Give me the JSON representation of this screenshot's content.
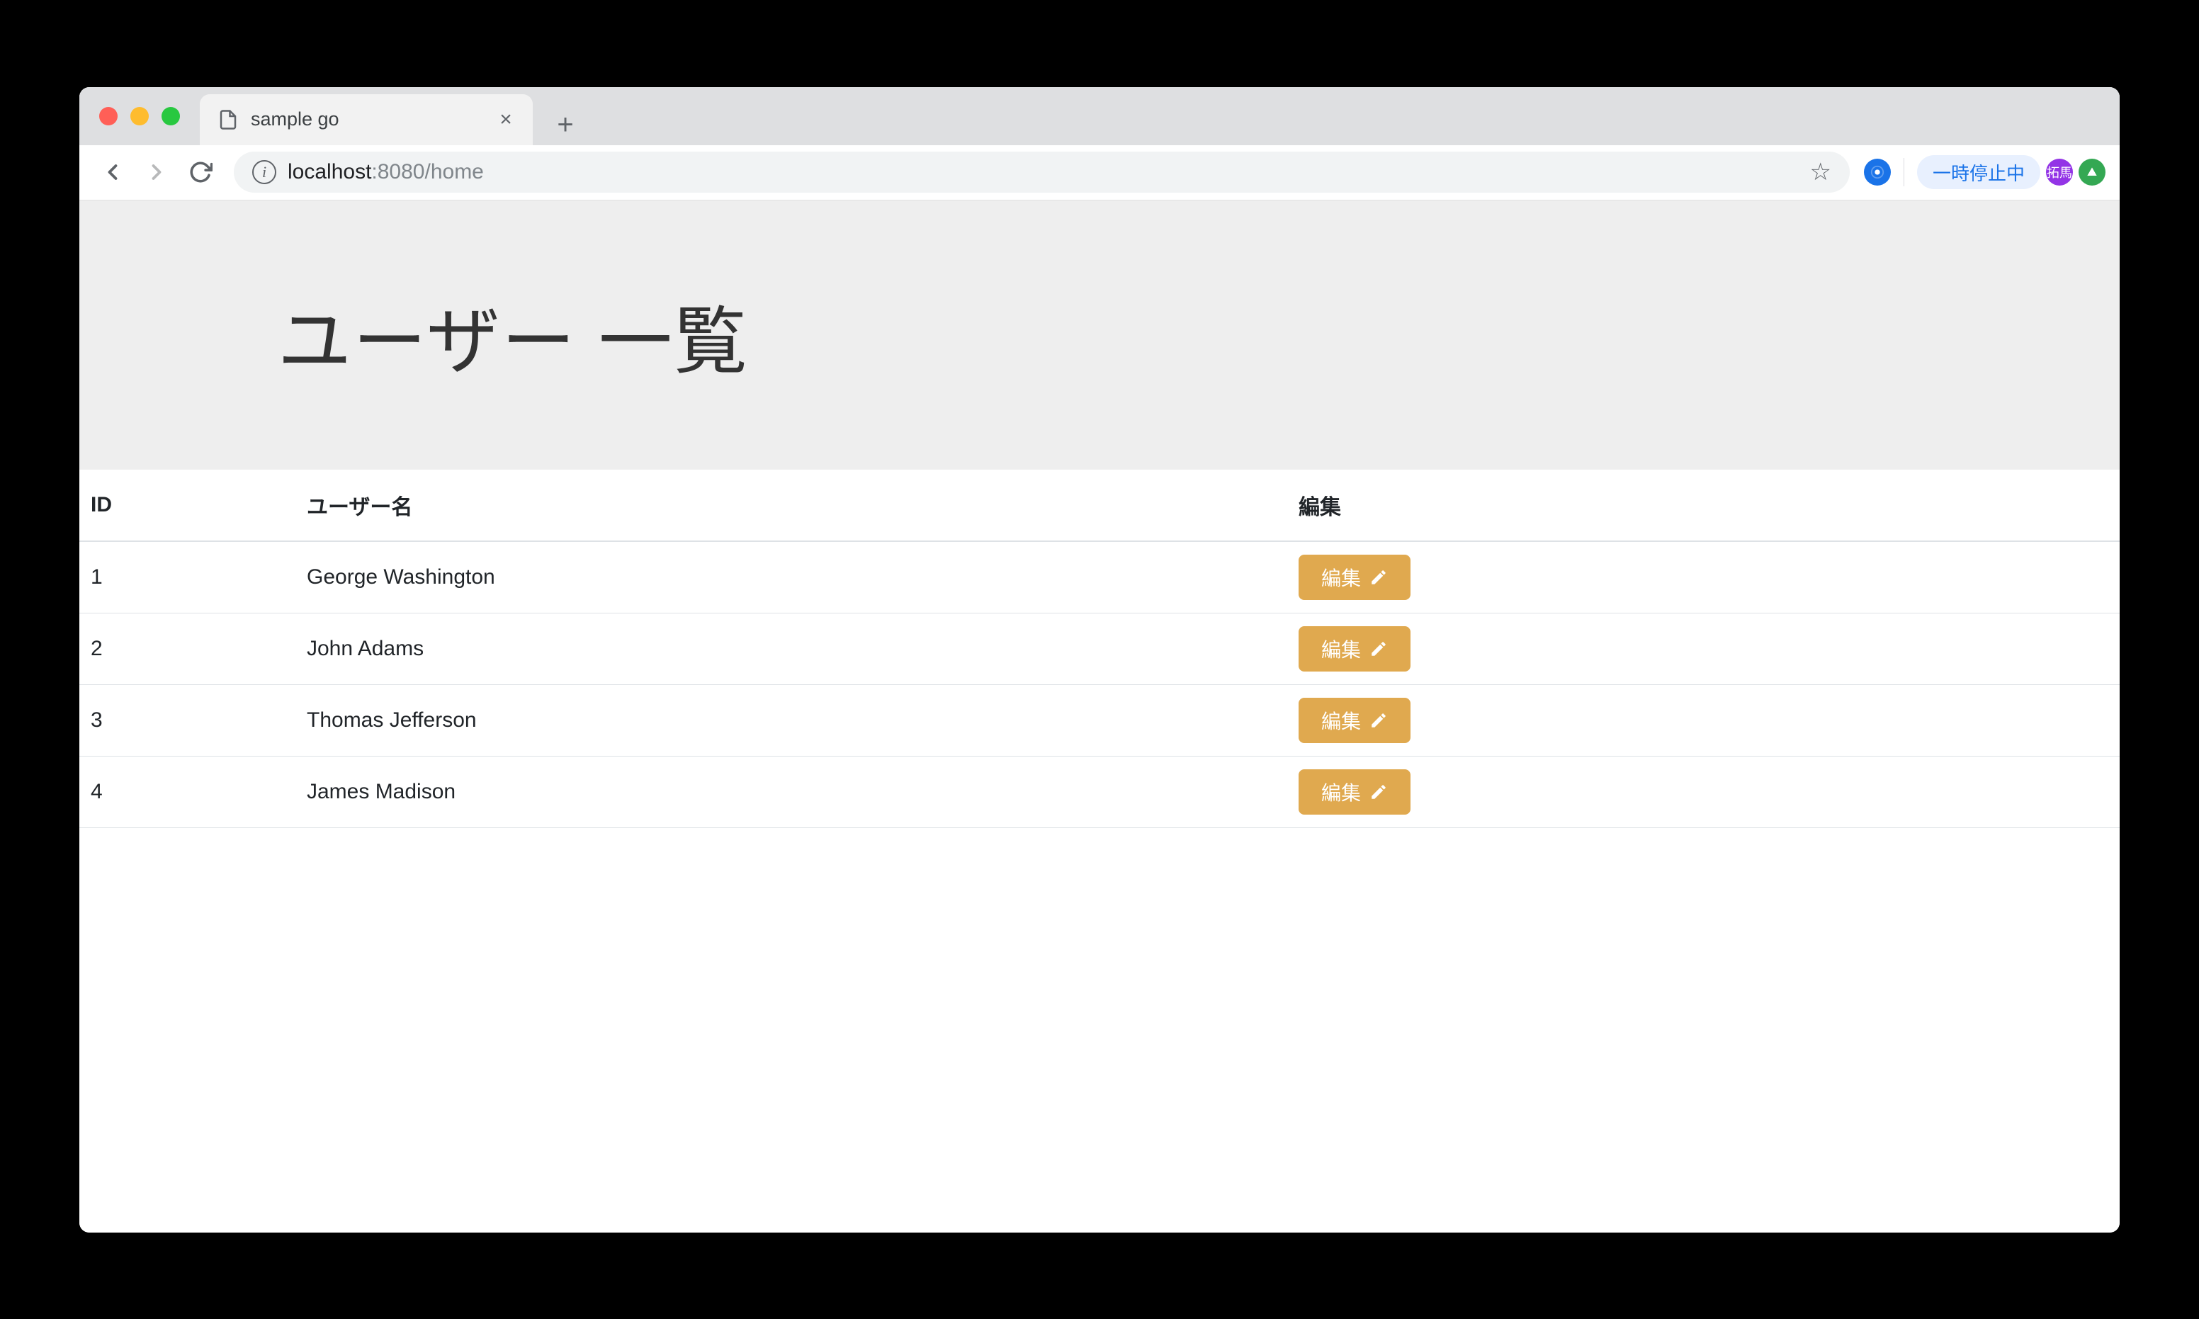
{
  "browser": {
    "tab_title": "sample go",
    "url_host": "localhost",
    "url_port": ":8080",
    "url_path": "/home",
    "pause_label": "一時停止中",
    "avatar_initials": "拓馬"
  },
  "page": {
    "heading": "ユーザー 一覧"
  },
  "table": {
    "headers": {
      "id": "ID",
      "name": "ユーザー名",
      "edit": "編集"
    },
    "edit_button_label": "編集",
    "rows": [
      {
        "id": "1",
        "name": "George Washington"
      },
      {
        "id": "2",
        "name": "John Adams"
      },
      {
        "id": "3",
        "name": "Thomas Jefferson"
      },
      {
        "id": "4",
        "name": "James Madison"
      }
    ]
  }
}
